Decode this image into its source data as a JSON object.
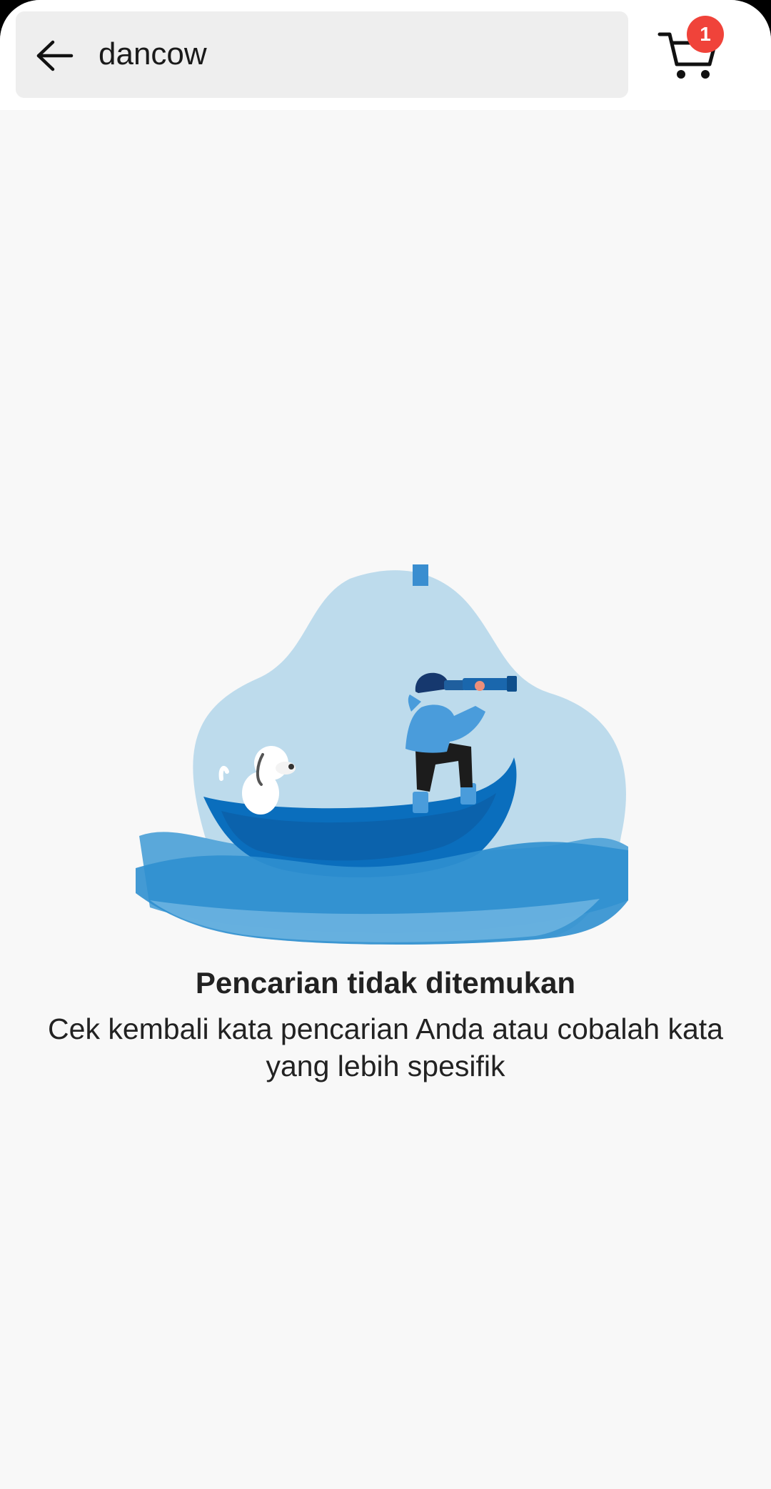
{
  "search": {
    "value": "dancow",
    "placeholder": ""
  },
  "cart": {
    "badge_count": "1"
  },
  "empty_state": {
    "title": "Pencarian tidak ditemukan",
    "subtitle": "Cek kembali kata pencarian Anda atau cobalah kata yang lebih spesifik"
  },
  "icons": {
    "back": "arrow-left-icon",
    "cart": "shopping-cart-icon",
    "illustration": "boat-telescope-illustration"
  },
  "colors": {
    "background": "#f8f8f8",
    "header": "#ffffff",
    "search_box": "#eeeeee",
    "badge": "#f0433a",
    "illustration_blob": "#bddbec",
    "boat": "#0a6ebd",
    "wave": "#3f98d4"
  }
}
